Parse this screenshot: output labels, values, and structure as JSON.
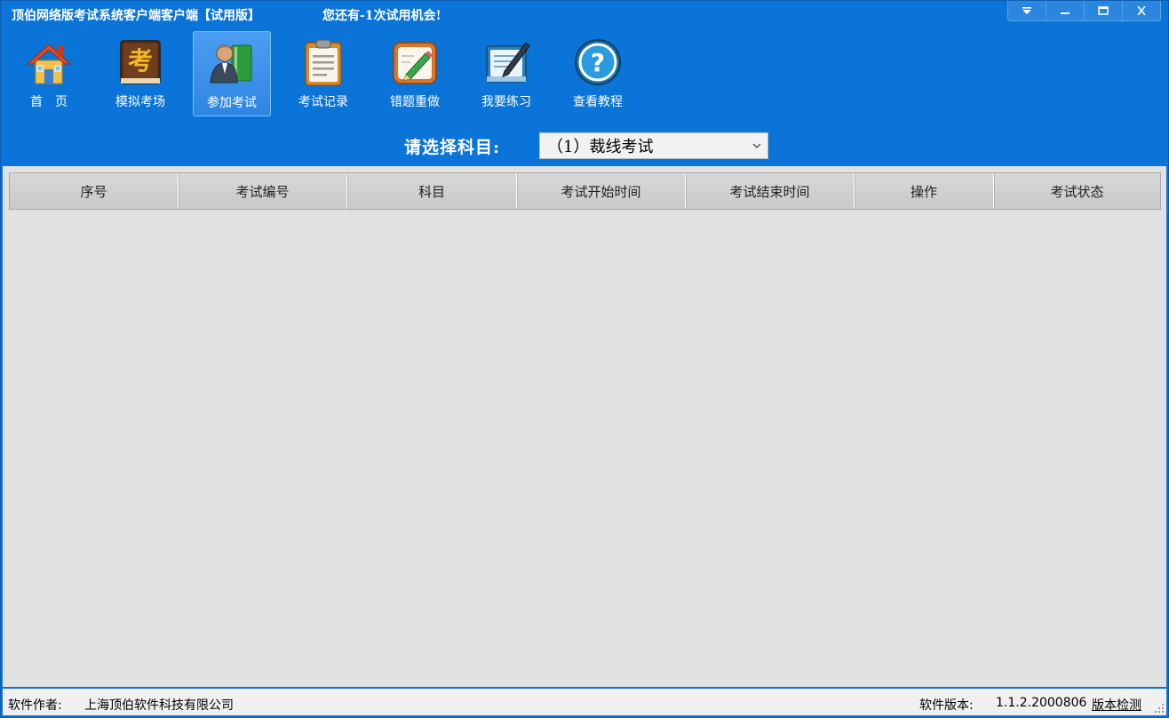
{
  "window": {
    "title": "顶伯网络版考试系统客户端客户端【试用版】",
    "trial_note": "您还有-1次试用机会!",
    "controls": [
      "menu-dropdown-icon",
      "minimize-icon",
      "maximize-icon",
      "close-icon"
    ]
  },
  "toolbar": {
    "items": [
      {
        "label": "首　页",
        "icon": "home-icon"
      },
      {
        "label": "模拟考场",
        "icon": "exam-book-icon"
      },
      {
        "label": "参加考试",
        "icon": "user-book-icon",
        "active": true
      },
      {
        "label": "考试记录",
        "icon": "clipboard-icon"
      },
      {
        "label": "错题重做",
        "icon": "edit-notebook-icon"
      },
      {
        "label": "我要练习",
        "icon": "practice-notebook-icon"
      },
      {
        "label": "查看教程",
        "icon": "help-icon"
      }
    ]
  },
  "subject": {
    "label": "请选择科目:",
    "selected": "（1）裁线考试"
  },
  "table": {
    "columns": [
      "序号",
      "考试编号",
      "科目",
      "考试开始时间",
      "考试结束时间",
      "操作",
      "考试状态"
    ],
    "rows": []
  },
  "statusbar": {
    "author_label": "软件作者:",
    "author": "上海顶伯软件科技有限公司",
    "version_label": "软件版本:",
    "version": "1.1.2.2000806",
    "check_link": "版本检测"
  },
  "colors": {
    "titlebar_bg": "#0a74d8",
    "content_bg": "#e1e1e1",
    "statusbar_bg": "#f0f0f0"
  }
}
